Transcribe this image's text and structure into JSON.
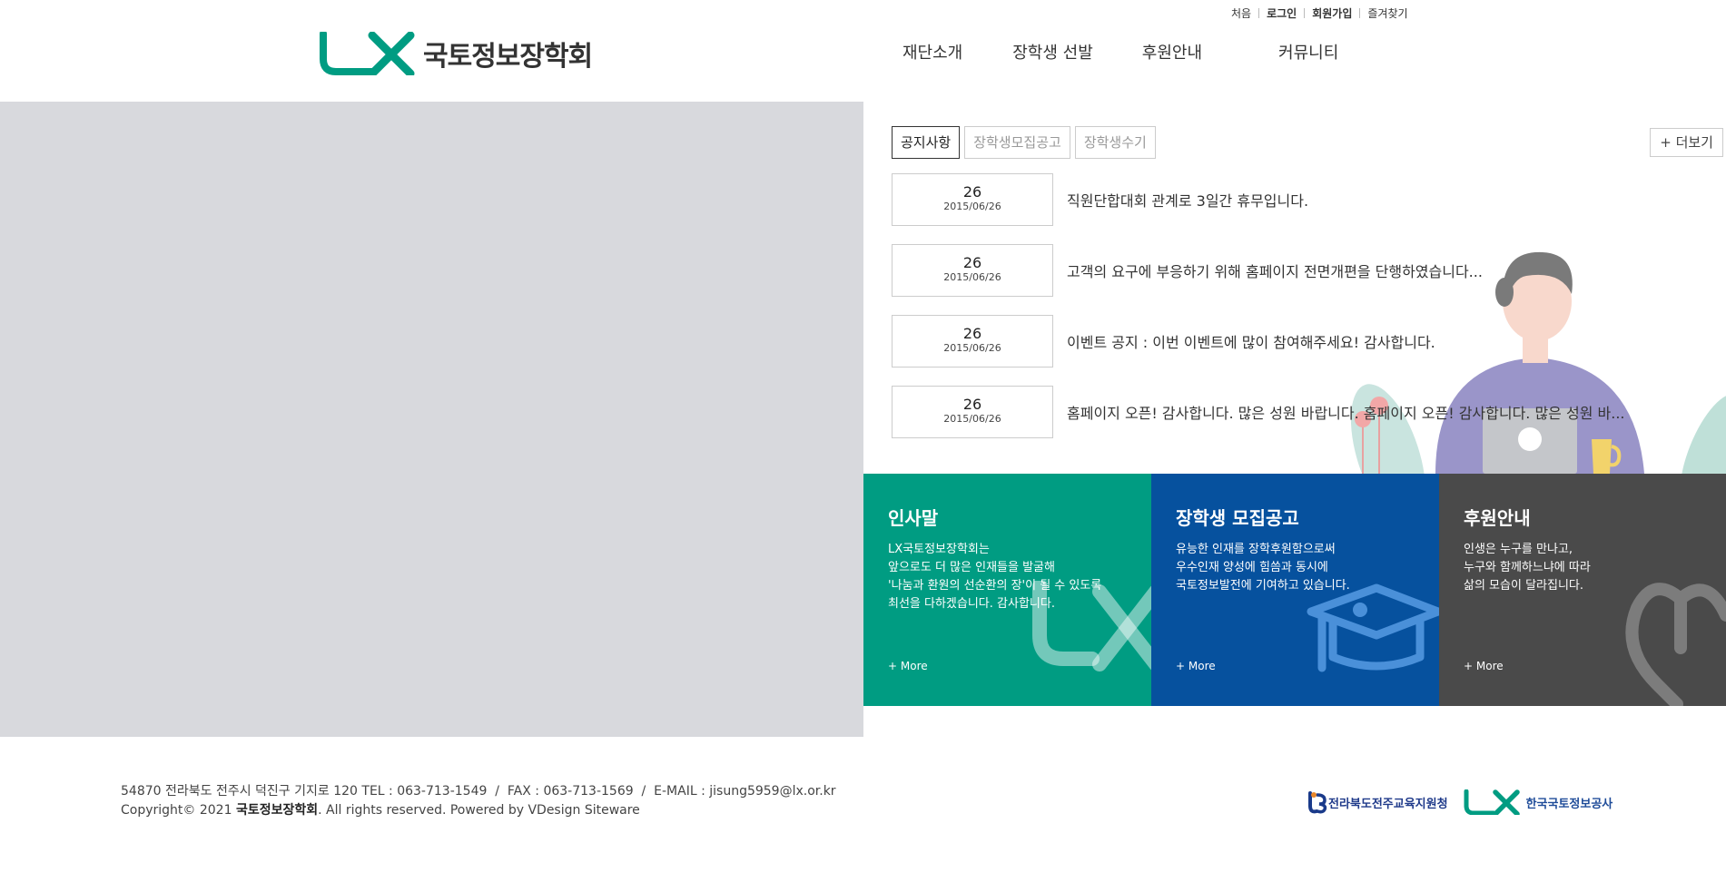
{
  "util_menu": [
    {
      "label": "처음",
      "bold": false
    },
    {
      "label": "로그인",
      "bold": true
    },
    {
      "label": "회원가입",
      "bold": true
    },
    {
      "label": "즐겨찾기",
      "bold": false
    }
  ],
  "brand": {
    "name": "국토정보장학회",
    "logo_icon": "lx-logo-mark",
    "accent": "#009c82"
  },
  "gnb": [
    "재단소개",
    "장학생 선발",
    "후원안내",
    "커뮤니티"
  ],
  "board": {
    "tabs": [
      "공지사항",
      "장학생모집공고",
      "장학생수기"
    ],
    "active_tab": 0,
    "more_label": "+ 더보기",
    "notices": [
      {
        "day": "26",
        "date": "2015/06/26",
        "title": "직원단합대회 관계로 3일간 휴무입니다."
      },
      {
        "day": "26",
        "date": "2015/06/26",
        "title": "고객의 요구에 부응하기 위해 홈페이지 전면개편을 단행하였습니다..."
      },
      {
        "day": "26",
        "date": "2015/06/26",
        "title": "이벤트 공지 : 이번 이벤트에 많이 참여해주세요! 감사합니다."
      },
      {
        "day": "26",
        "date": "2015/06/26",
        "title": "홈페이지 오픈! 감사합니다. 많은 성원 바랍니다. 홈페이지 오픈! 감사합니다. 많은 성원 바..."
      }
    ]
  },
  "quick_boxes": [
    {
      "title": "인사말",
      "desc": "LX국토정보장학회는\n앞으로도 더 많은 인재들을 발굴해\n'나눔과 환원의 선순환의 장'이 될 수 있도록\n최선을 다하겠습니다. 감사합니다.",
      "more": "+ More",
      "color": "#009c82",
      "icon": "lx-watermark-icon"
    },
    {
      "title": "장학생 모집공고",
      "desc": "유능한 인재를 장학후원함으로써\n우수인재 양성에 힘씀과 동시에\n국토정보발전에 기여하고 있습니다.",
      "more": "+ More",
      "color": "#06519e",
      "icon": "graduation-cap-icon"
    },
    {
      "title": "후원안내",
      "desc": "인생은 누구를 만나고,\n누구와 함께하느냐에 따라\n삶의 모습이 달라집니다.",
      "more": "+ More",
      "color": "#4a4a4a",
      "icon": "heart-icon"
    }
  ],
  "footer": {
    "address": "54870 전라북도 전주시 덕진구 기지로 120 TEL : 063-713-1549  /  FAX : 063-713-1569  /  E-MAIL : jisung5959@lx.or.kr",
    "copyright_prefix": "Copyright© 2021 ",
    "copyright_name": "국토정보장학회",
    "copyright_suffix": ". All rights reserved. Powered by VDesign Siteware",
    "partners": [
      {
        "name": "전라북도전주교육지원청",
        "icon": "jeonbuk-education-logo-icon"
      },
      {
        "name": "한국국토정보공사",
        "icon": "lx-corp-logo-icon"
      }
    ]
  }
}
